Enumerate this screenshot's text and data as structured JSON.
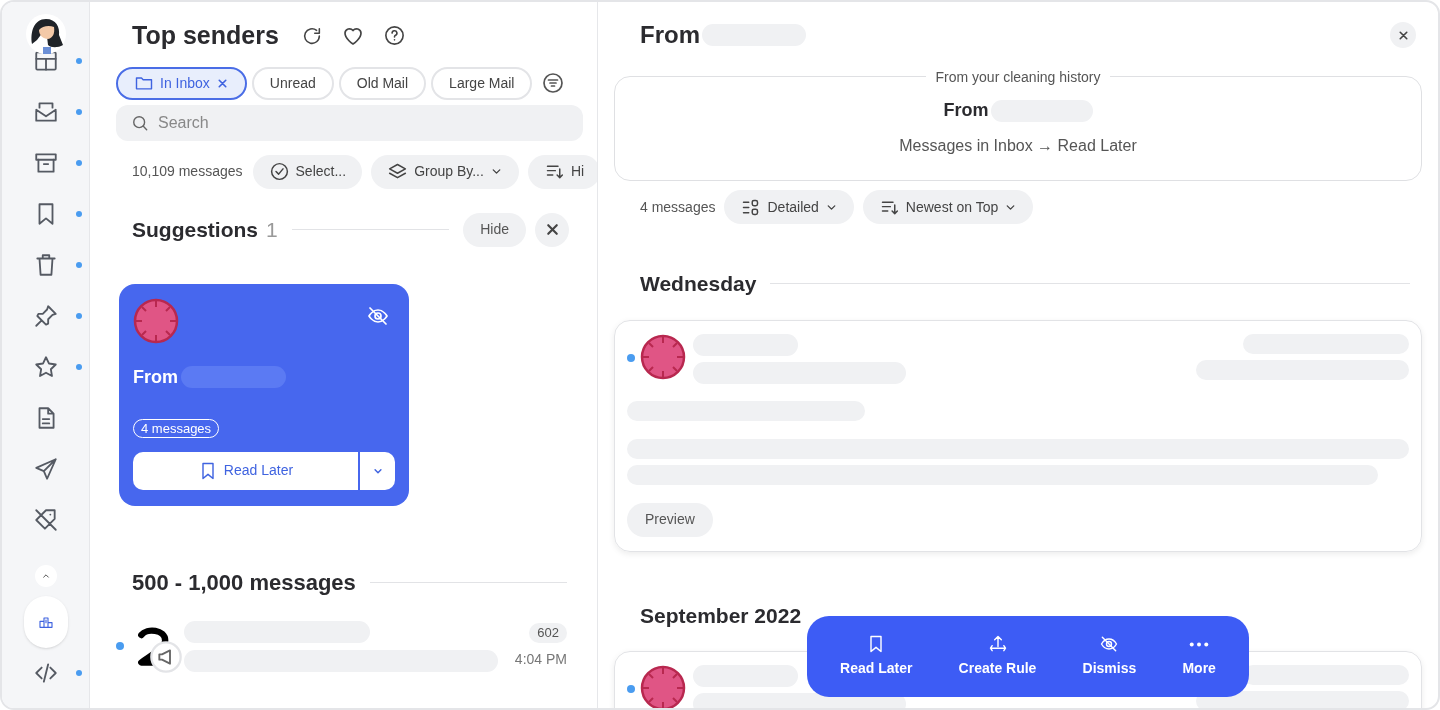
{
  "sidebar": {
    "items": [
      {
        "kind": "nav",
        "dot": true,
        "selected": false
      },
      {
        "kind": "nav",
        "dot": true,
        "selected": false
      },
      {
        "kind": "nav",
        "dot": true,
        "selected": false
      },
      {
        "kind": "nav",
        "dot": true,
        "selected": false
      },
      {
        "kind": "nav",
        "dot": true,
        "selected": false
      },
      {
        "kind": "nav",
        "dot": true,
        "selected": false
      },
      {
        "kind": "nav",
        "dot": true,
        "selected": false
      },
      {
        "kind": "nav",
        "dot": false,
        "selected": false
      },
      {
        "kind": "nav",
        "dot": false,
        "selected": false
      },
      {
        "kind": "nav",
        "dot": false,
        "selected": false
      },
      {
        "kind": "collapse",
        "dot": false,
        "selected": false
      },
      {
        "kind": "nav",
        "dot": false,
        "selected": true
      },
      {
        "kind": "nav",
        "dot": true,
        "selected": false
      }
    ]
  },
  "senders": {
    "title": "Top senders",
    "filters": [
      {
        "label": "In Inbox",
        "selected": true
      },
      {
        "label": "Unread",
        "selected": false
      },
      {
        "label": "Old Mail",
        "selected": false
      },
      {
        "label": "Large Mail",
        "selected": false
      }
    ],
    "search": {
      "placeholder": "Search"
    },
    "count": "10,109 messages",
    "toolbar": [
      {
        "label": "Select...",
        "kind": "select"
      },
      {
        "label": "Group By...",
        "kind": "group"
      },
      {
        "label": "Hi",
        "kind": "sort"
      }
    ],
    "suggestions": {
      "title": "Suggestions",
      "count": "1",
      "hide": "Hide",
      "card": {
        "from": "From",
        "badge": "4 messages",
        "action": "Read Later"
      }
    },
    "sections": [
      {
        "title": "500 - 1,000 messages",
        "rows": [
          {
            "unread": true,
            "count": "602",
            "time": "4:04 PM"
          }
        ]
      }
    ]
  },
  "detail": {
    "title": "From",
    "history": {
      "legend": "From your cleaning history",
      "from": "From",
      "rule": "Messages in Inbox → Read Later"
    },
    "count": "4 messages",
    "toolbar": [
      {
        "label": "Detailed",
        "kind": "view"
      },
      {
        "label": "Newest on Top",
        "kind": "sort"
      }
    ],
    "groups": [
      {
        "title": "Wednesday",
        "messages": [
          {
            "unread": true,
            "preview": "Preview"
          }
        ]
      },
      {
        "title": "September 2022",
        "messages": [
          {
            "unread": true
          }
        ]
      }
    ],
    "actions": [
      {
        "label": "Read Later",
        "kind": "bookmark"
      },
      {
        "label": "Create Rule",
        "kind": "rule"
      },
      {
        "label": "Dismiss",
        "kind": "dismiss"
      },
      {
        "label": "More",
        "kind": "more"
      }
    ]
  }
}
